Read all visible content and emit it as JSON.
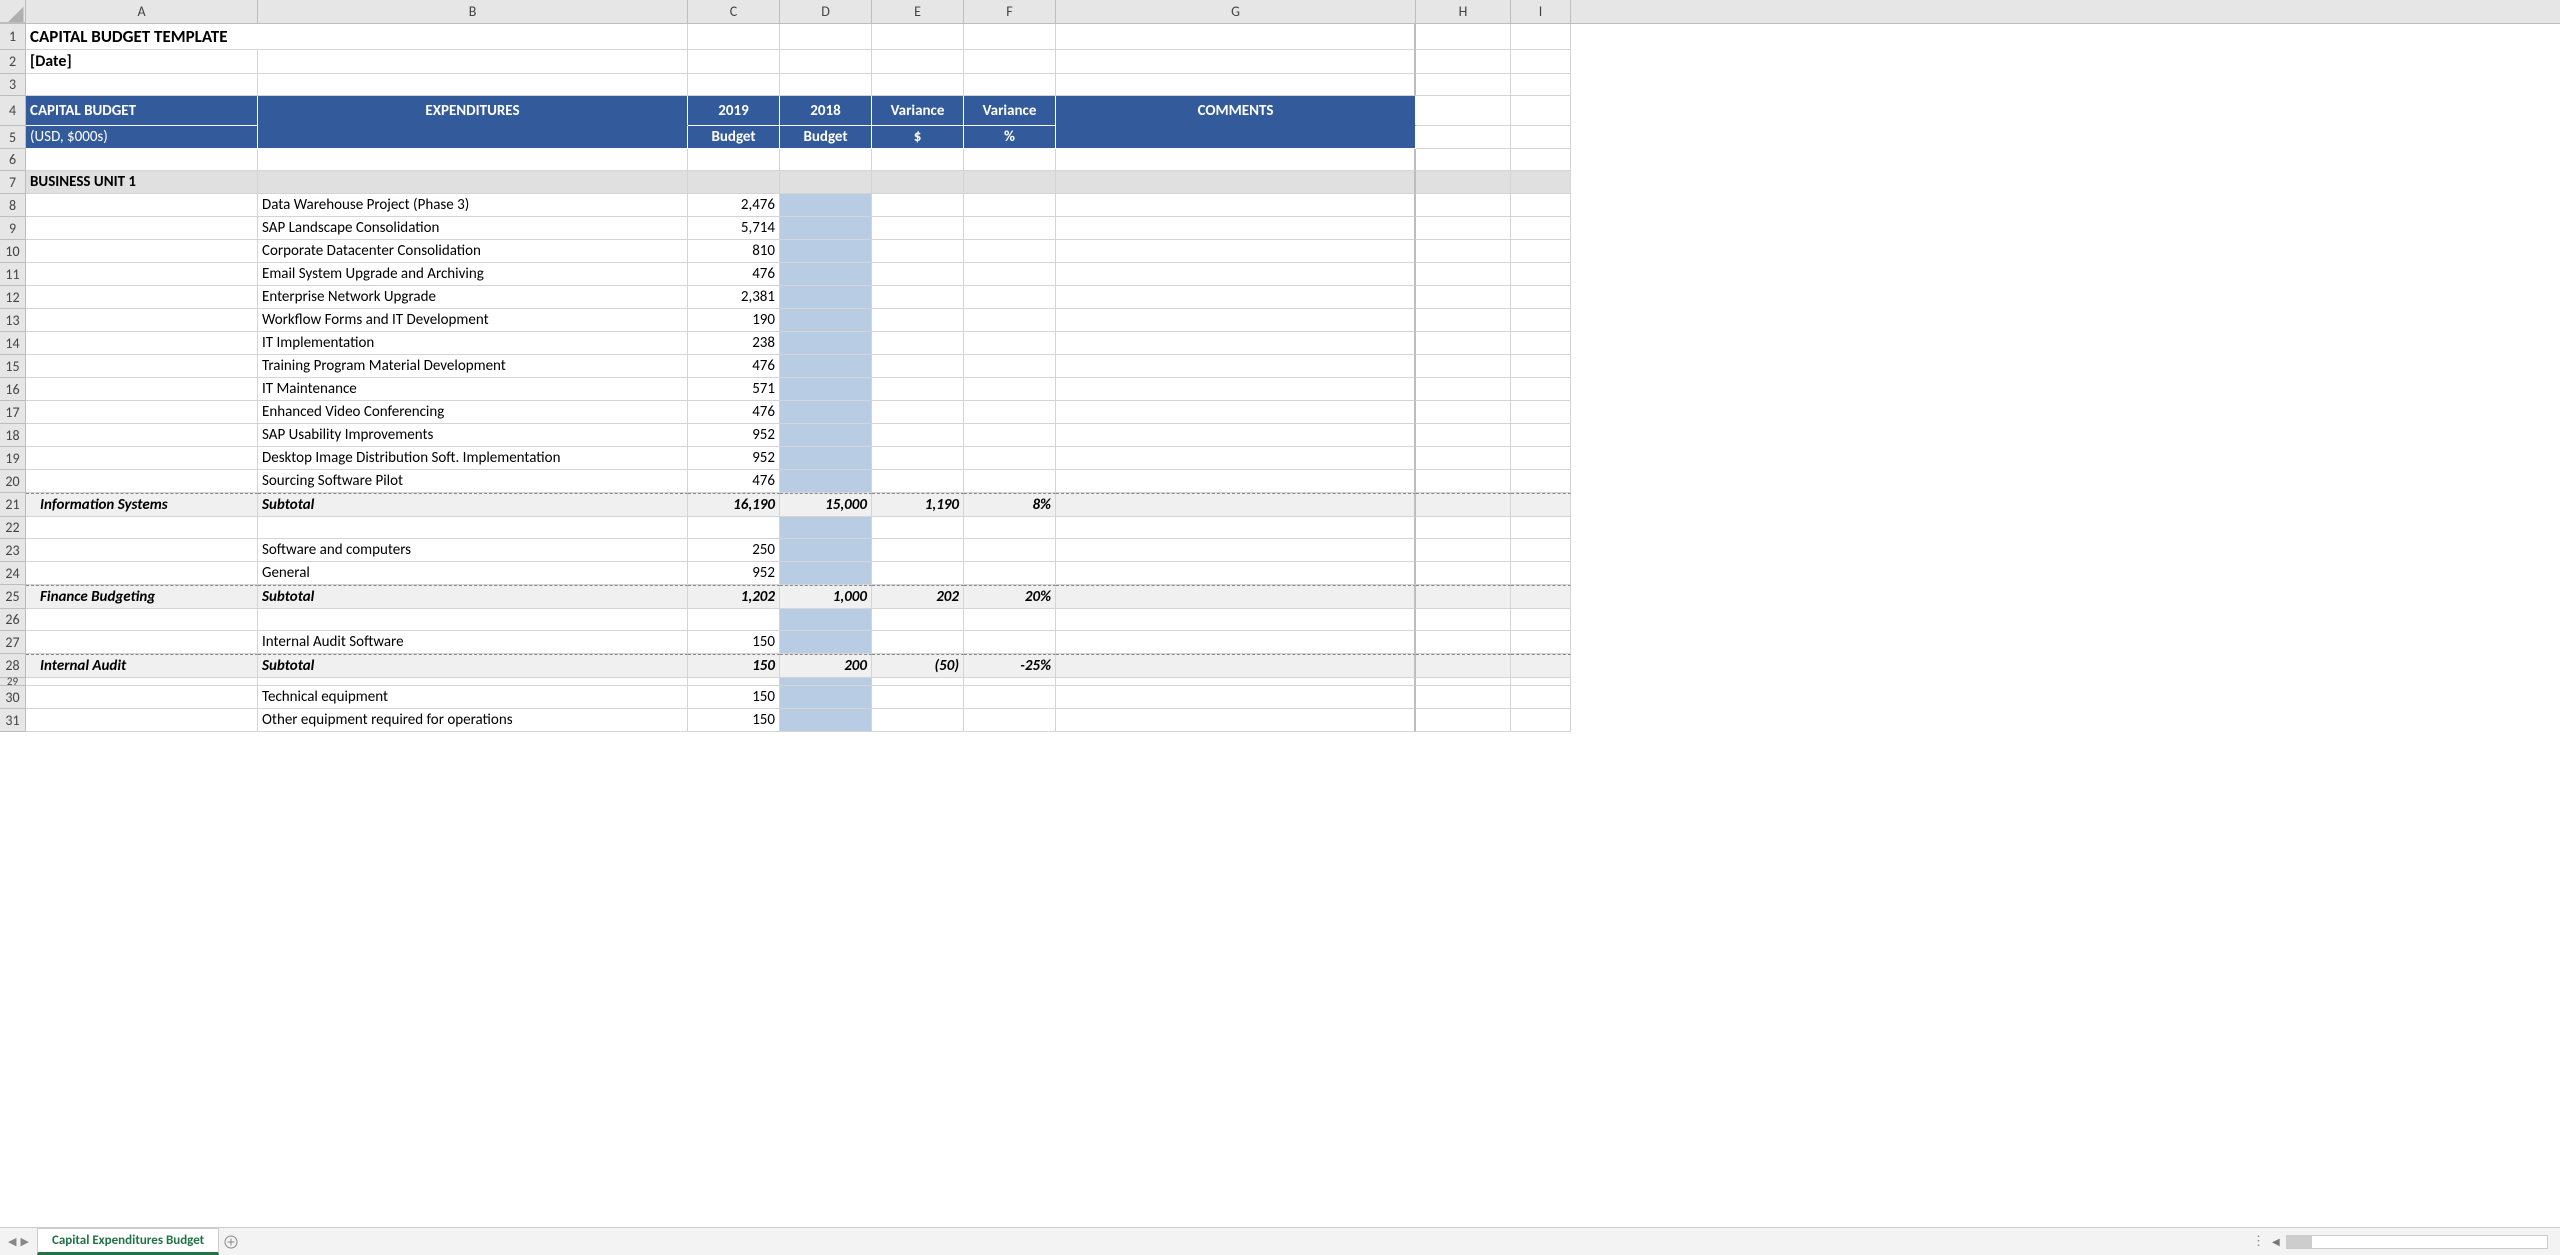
{
  "columns": [
    "A",
    "B",
    "C",
    "D",
    "E",
    "F",
    "G",
    "H",
    "I"
  ],
  "title": "CAPITAL BUDGET TEMPLATE",
  "date_placeholder": "[Date]",
  "header": {
    "a_top": "CAPITAL BUDGET",
    "a_bot": "(USD, $000s)",
    "b": "EXPENDITURES",
    "c_top": "2019",
    "c_bot": "Budget",
    "d_top": "2018",
    "d_bot": "Budget",
    "e_top": "Variance",
    "e_bot": "$",
    "f_top": "Variance",
    "f_bot": "%",
    "g": "COMMENTS"
  },
  "bu1_label": "BUSINESS UNIT 1",
  "is_items": [
    {
      "b": "Data Warehouse Project (Phase 3)",
      "c": "2,476"
    },
    {
      "b": "SAP Landscape Consolidation",
      "c": "5,714"
    },
    {
      "b": "Corporate Datacenter Consolidation",
      "c": "810"
    },
    {
      "b": "Email System Upgrade and Archiving",
      "c": "476"
    },
    {
      "b": "Enterprise Network Upgrade",
      "c": "2,381"
    },
    {
      "b": "Workflow Forms and IT Development",
      "c": "190"
    },
    {
      "b": "IT Implementation",
      "c": "238"
    },
    {
      "b": "Training Program Material Development",
      "c": "476"
    },
    {
      "b": "IT Maintenance",
      "c": "571"
    },
    {
      "b": "Enhanced Video Conferencing",
      "c": "476"
    },
    {
      "b": "SAP Usability Improvements",
      "c": "952"
    },
    {
      "b": "Desktop Image Distribution Soft. Implementation",
      "c": "952"
    },
    {
      "b": "Sourcing Software Pilot",
      "c": "476"
    }
  ],
  "is_sub": {
    "a": "Information Systems",
    "b": "Subtotal",
    "c": "16,190",
    "d": "15,000",
    "e": "1,190",
    "f": "8%"
  },
  "fb_items": [
    {
      "b": "Software and computers",
      "c": "250"
    },
    {
      "b": "General",
      "c": "952"
    }
  ],
  "fb_sub": {
    "a": "Finance Budgeting",
    "b": "Subtotal",
    "c": "1,202",
    "d": "1,000",
    "e": "202",
    "f": "20%"
  },
  "ia_items": [
    {
      "b": "Internal Audit Software",
      "c": "150"
    }
  ],
  "ia_sub": {
    "a": "Internal Audit",
    "b": "Subtotal",
    "c": "150",
    "d": "200",
    "e": "(50)",
    "f": "-25%"
  },
  "next_items": [
    {
      "b": "Technical equipment",
      "c": "150"
    },
    {
      "b": "Other equipment required for operations",
      "c": "150"
    }
  ],
  "sheet_tab": "Capital Expenditures Budget"
}
